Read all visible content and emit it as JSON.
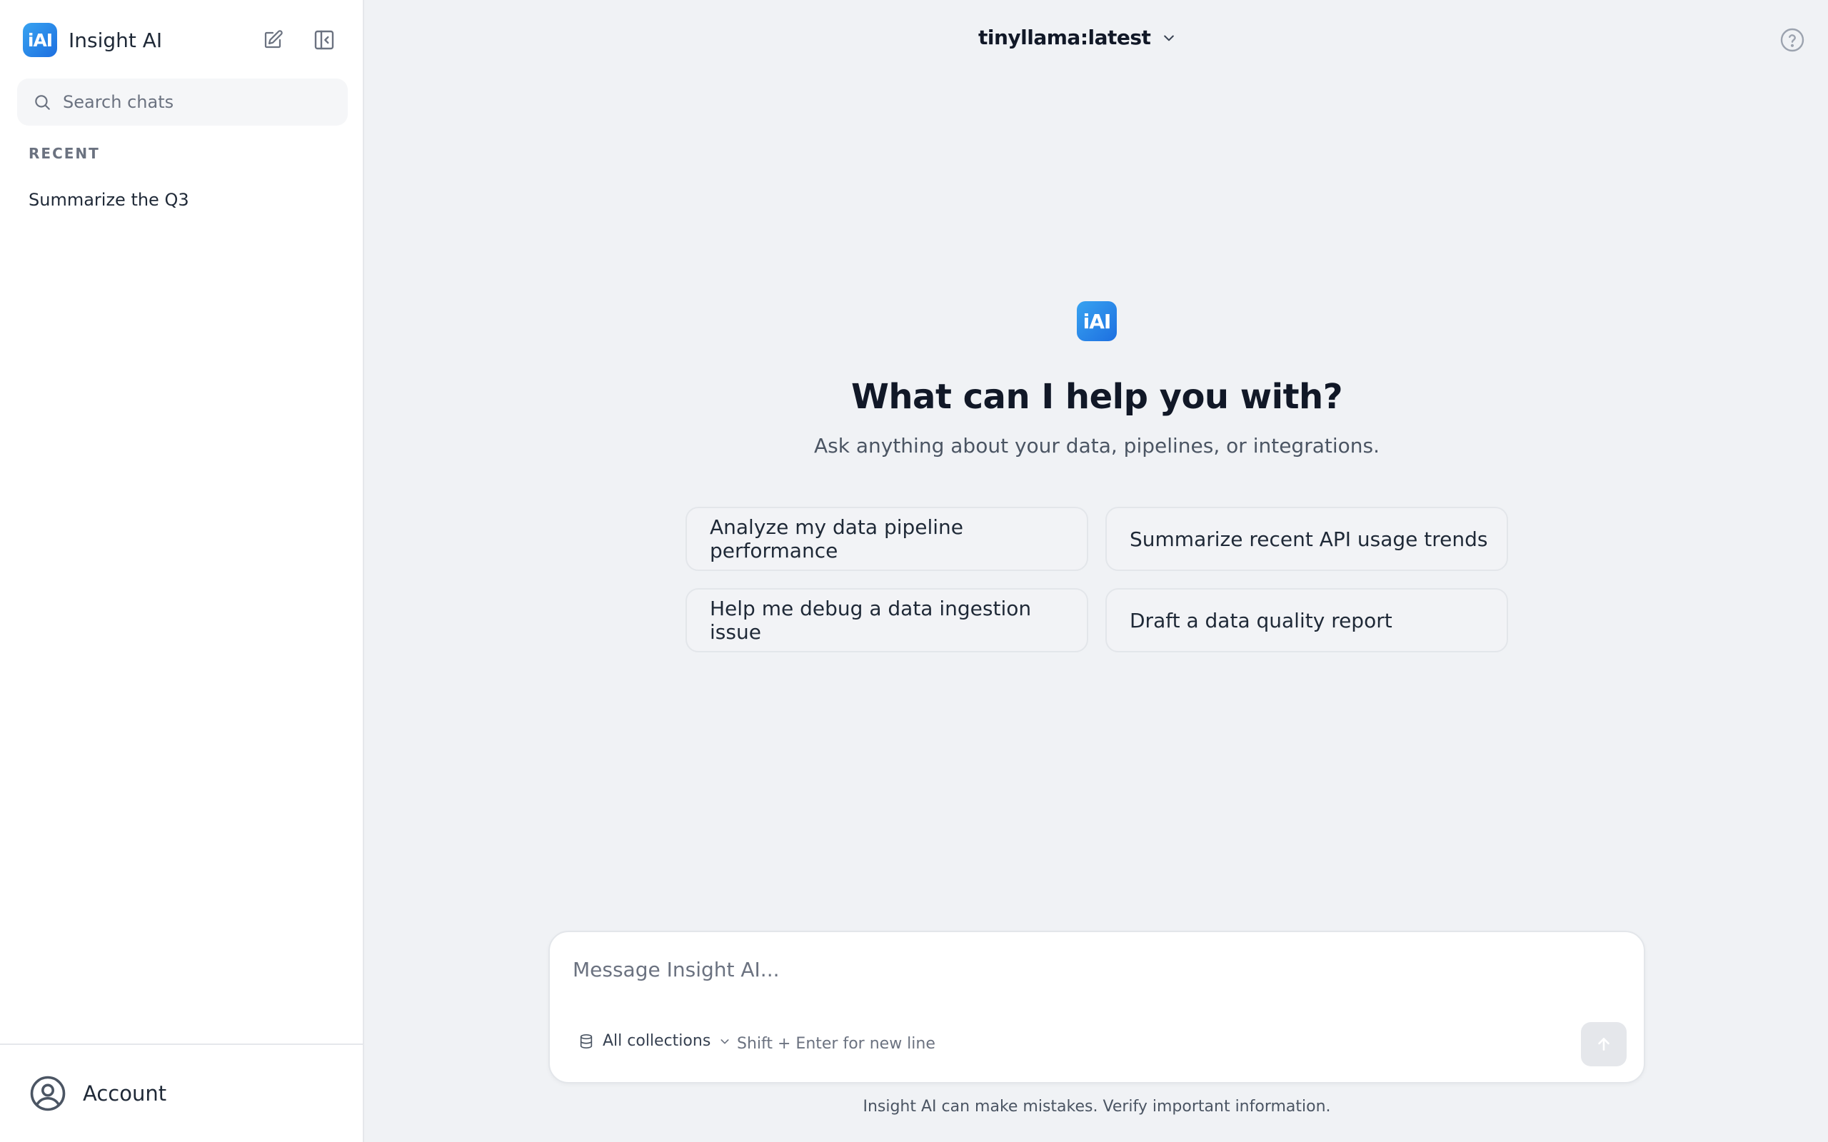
{
  "sidebar": {
    "brand": {
      "logo_text": "iAI",
      "name": "Insight AI"
    },
    "new_chat_icon": "pencil-square-icon",
    "collapse_icon": "sidebar-collapse-icon",
    "search": {
      "placeholder": "Search chats"
    },
    "recent_label": "RECENT",
    "chats": [
      {
        "title": "Summarize the Q3"
      }
    ],
    "account": {
      "label": "Account",
      "icon": "user-circle-icon"
    }
  },
  "header": {
    "model": "tinyllama:latest",
    "help_icon": "question-circle-icon"
  },
  "hero": {
    "logo_text": "iAI",
    "title": "What can I help you with?",
    "subtitle": "Ask anything about your data, pipelines, or integrations."
  },
  "suggestions": [
    "Analyze my data pipeline performance",
    "Summarize recent API usage trends",
    "Help me debug a data ingestion issue",
    "Draft a data quality report"
  ],
  "composer": {
    "placeholder": "Message Insight AI...",
    "value": "",
    "collections_label": "All collections",
    "hint": "Shift + Enter for new line",
    "send_icon": "arrow-up-icon"
  },
  "footer": {
    "disclaimer": "Insight AI can make mistakes. Verify important information."
  },
  "colors": {
    "brand_gradient_start": "#38a3f1",
    "brand_gradient_end": "#1d6fe0",
    "background": "#f0f2f5",
    "sidebar": "#ffffff"
  }
}
